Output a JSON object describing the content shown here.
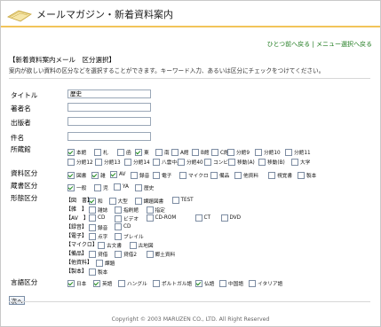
{
  "header": {
    "title": "メールマガジン・新着資料案内",
    "accent": "#f2c45a"
  },
  "nav": {
    "back": "ひとつ前へ戻る",
    "sep": "|",
    "menu": "メニュー選択へ戻る"
  },
  "section_title": "【新着資料案内メール　区分選択】",
  "description": "案内が欲しい資料の区分などを選択することができます。キーワード入力、あるいは区分にチェックをつけてください。",
  "fields": [
    {
      "label": "タイトル",
      "value": "歴史"
    },
    {
      "label": "著者名",
      "value": ""
    },
    {
      "label": "出版者",
      "value": ""
    },
    {
      "label": "件名",
      "value": ""
    }
  ],
  "labels": {
    "location": "所蔵館",
    "material": "資料区分",
    "holding": "蔵書区分",
    "form": "形態区分",
    "language": "言語区分"
  },
  "location_row1": [
    "本館",
    "札",
    "函",
    "東",
    "南",
    "A館",
    "B館",
    "C館",
    "分館9",
    "分館10",
    "分館11"
  ],
  "location_row1_checked": [
    true,
    false,
    false,
    true,
    false,
    false,
    false,
    false,
    false,
    false,
    false
  ],
  "location_row2": [
    "分館12",
    "分館13",
    "分館14",
    "八雲中央",
    "分館40",
    "コンビニ",
    "移動(A)",
    "移動(B)",
    "大学"
  ],
  "material_opts": [
    "図書",
    "雑",
    "AV",
    "録音",
    "電子",
    "マイクロ",
    "備品",
    "他資料",
    "視覚書",
    "製本"
  ],
  "material_checked": [
    true,
    true,
    true,
    false,
    false,
    false,
    false,
    false,
    false,
    false
  ],
  "holding_opts": [
    "一般",
    "児",
    "YA",
    "歴史"
  ],
  "holding_checked": [
    true,
    false,
    false,
    false
  ],
  "form_groups": [
    {
      "tag": "【図　書】",
      "opts": [
        "和",
        "大型",
        "課題図書",
        "TEST"
      ],
      "checked": [
        true,
        false,
        false,
        false
      ]
    },
    {
      "tag": "【雑　】",
      "opts": [
        "雑誌",
        "指刷館",
        "指定"
      ],
      "checked": [
        false,
        false,
        false
      ]
    },
    {
      "tag": "【AV　】",
      "opts": [
        "CD",
        "ビデオ",
        "CD-ROM",
        "CT",
        "DVD"
      ],
      "checked": [
        false,
        false,
        false,
        false,
        false
      ]
    },
    {
      "tag": "【録音】",
      "opts": [
        "録音",
        "CD"
      ],
      "checked": [
        false,
        false
      ]
    },
    {
      "tag": "【電子】",
      "opts": [
        "点字",
        "ブレイル"
      ],
      "checked": [
        false,
        false
      ]
    },
    {
      "tag": "【マイクロ】",
      "opts": [
        "古文書",
        "古地図"
      ],
      "checked": [
        false,
        false
      ]
    },
    {
      "tag": "【備品】",
      "opts": [
        "貸借",
        "貸借2",
        "郷土資料"
      ],
      "checked": [
        false,
        false,
        false
      ]
    },
    {
      "tag": "【他資料】",
      "opts": [
        "課題"
      ],
      "checked": [
        false
      ]
    },
    {
      "tag": "【製本】",
      "opts": [
        "製本"
      ],
      "checked": [
        false
      ]
    }
  ],
  "language_opts": [
    "日本",
    "英語",
    "ハングル",
    "ポルトガル語",
    "仏語",
    "中国語",
    "イタリア語"
  ],
  "language_checked": [
    true,
    true,
    false,
    false,
    true,
    false,
    false
  ],
  "next_button": "次へ",
  "copyright": "Copyright © 2003 MARUZEN CO., LTD. All Right Reserved"
}
